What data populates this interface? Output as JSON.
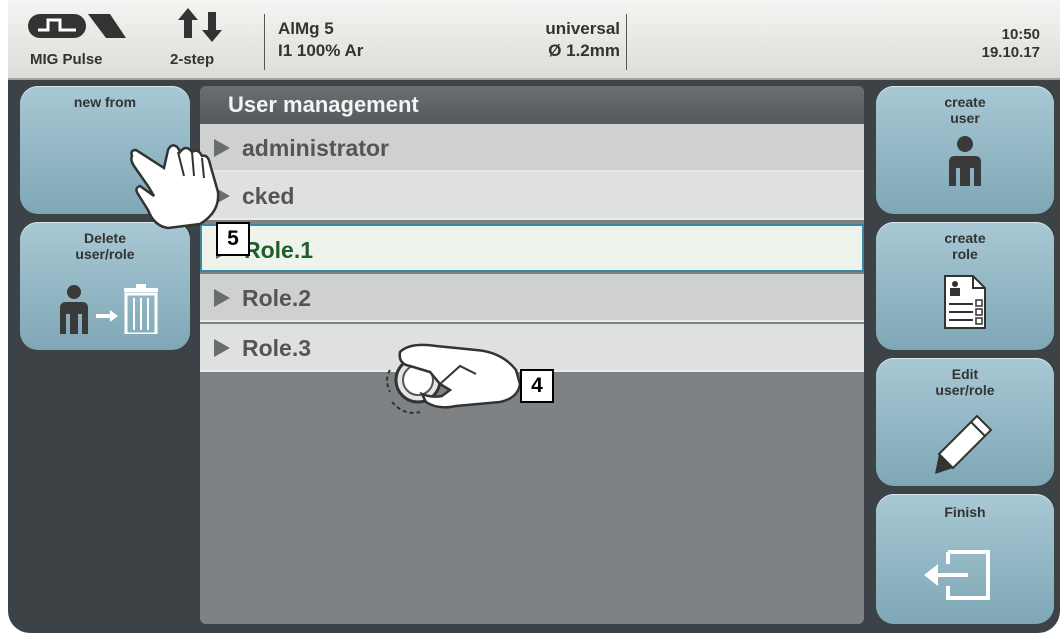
{
  "header": {
    "mode_label": "MIG Pulse",
    "step_label": "2-step",
    "material_line1": "AlMg 5",
    "material_line2": "I1 100% Ar",
    "wire_line1": "universal",
    "wire_line2": "Ø  1.2mm",
    "time": "10:50",
    "date": "19.10.17"
  },
  "left_buttons": {
    "new_from": "new from",
    "delete_line1": "Delete",
    "delete_line2": "user/role"
  },
  "right_buttons": {
    "create_user_1": "create",
    "create_user_2": "user",
    "create_role_1": "create",
    "create_role_2": "role",
    "edit_1": "Edit",
    "edit_2": "user/role",
    "finish": "Finish"
  },
  "list": {
    "title": "User management",
    "items": [
      "administrator",
      "cked",
      "Role.1",
      "Role.2",
      "Role.3"
    ],
    "selected_index": 2
  },
  "callouts": {
    "touch": "5",
    "dial": "4"
  },
  "colors": {
    "button": "#8fb3c1",
    "background": "#3d4246",
    "selection_border": "#3f86a0",
    "selected_text": "#1f5e2a"
  }
}
